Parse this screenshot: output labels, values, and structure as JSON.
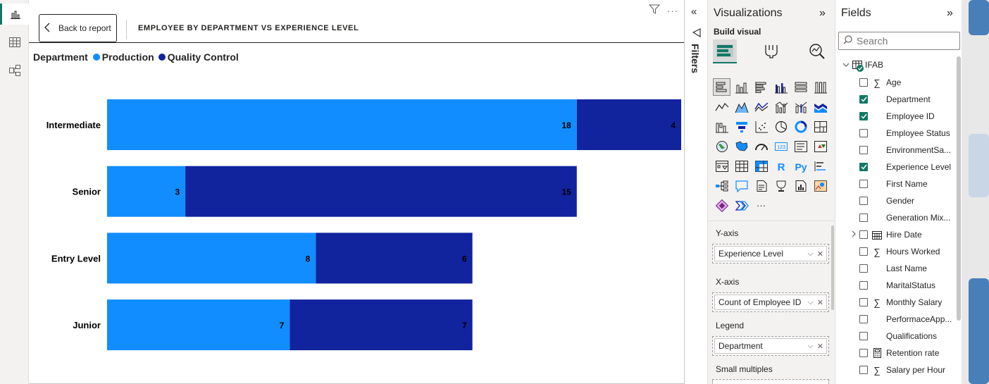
{
  "rail": {
    "items": [
      {
        "name": "report-view-icon",
        "active": true
      },
      {
        "name": "table-view-icon",
        "active": false
      },
      {
        "name": "model-view-icon",
        "active": false
      }
    ]
  },
  "canvas": {
    "back_label": "Back to report",
    "visual_title": "EMPLOYEE BY DEPARTMENT VS EXPERIENCE LEVEL",
    "legend": {
      "title": "Department",
      "items": [
        {
          "label": "Production",
          "color": "#118dff"
        },
        {
          "label": "Quality Control",
          "color": "#12239e"
        }
      ]
    }
  },
  "chart_data": {
    "type": "bar",
    "orientation": "horizontal",
    "stacked": true,
    "categories": [
      "Intermediate",
      "Senior",
      "Entry Level",
      "Junior"
    ],
    "series": [
      {
        "name": "Production",
        "color": "#118dff",
        "values": [
          18,
          3,
          8,
          7
        ]
      },
      {
        "name": "Quality Control",
        "color": "#12239e",
        "values": [
          4,
          15,
          6,
          7
        ]
      }
    ],
    "xlim": [
      0,
      22
    ],
    "grid": false,
    "legend_position": "top-left",
    "data_labels": true
  },
  "filters": {
    "label": "Filters"
  },
  "visualizations": {
    "title": "Visualizations",
    "build_label": "Build visual",
    "more_label": "···",
    "wells": [
      {
        "label": "Y-axis",
        "value": "Experience Level"
      },
      {
        "label": "X-axis",
        "value": "Count of Employee ID"
      },
      {
        "label": "Legend",
        "value": "Department"
      },
      {
        "label": "Small multiples",
        "value": ""
      }
    ]
  },
  "fields": {
    "title": "Fields",
    "search_placeholder": "Search",
    "table_name": "IFAB",
    "items": [
      {
        "label": "Age",
        "icon": "sigma",
        "checked": false
      },
      {
        "label": "Department",
        "icon": "",
        "checked": true
      },
      {
        "label": "Employee ID",
        "icon": "",
        "checked": true
      },
      {
        "label": "Employee Status",
        "icon": "",
        "checked": false
      },
      {
        "label": "EnvironmentSa...",
        "icon": "",
        "checked": false
      },
      {
        "label": "Experience Level",
        "icon": "",
        "checked": true
      },
      {
        "label": "First Name",
        "icon": "",
        "checked": false
      },
      {
        "label": "Gender",
        "icon": "",
        "checked": false
      },
      {
        "label": "Generation Mix...",
        "icon": "",
        "checked": false
      },
      {
        "label": "Hire Date",
        "icon": "calendar",
        "checked": false,
        "expandable": true
      },
      {
        "label": "Hours Worked",
        "icon": "sigma",
        "checked": false
      },
      {
        "label": "Last Name",
        "icon": "",
        "checked": false
      },
      {
        "label": "MaritalStatus",
        "icon": "",
        "checked": false
      },
      {
        "label": "Monthly Salary",
        "icon": "sigma",
        "checked": false
      },
      {
        "label": "PerformaceApp...",
        "icon": "",
        "checked": false
      },
      {
        "label": "Qualifications",
        "icon": "",
        "checked": false
      },
      {
        "label": "Retention rate",
        "icon": "calculator",
        "checked": false
      },
      {
        "label": "Salary per Hour",
        "icon": "sigma",
        "checked": false
      }
    ]
  }
}
